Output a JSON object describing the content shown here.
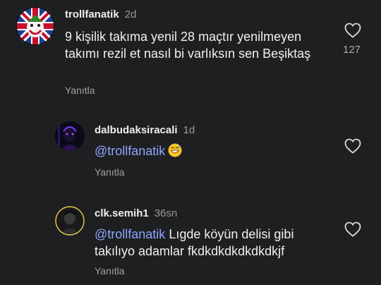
{
  "comments": [
    {
      "username": "trollfanatik",
      "time": "2d",
      "text": "9 kişilik takıma yenil 28 maçtır yenilmeyen takımı rezil et nasıl bi varlıksın sen Beşiktaş",
      "reply_label": "Yanıtla",
      "likes": "127"
    },
    {
      "username": "dalbudaksiracali",
      "time": "1d",
      "mention": "@trollfanatik",
      "text": "",
      "emoji": "grinning-sweat-face-emoji",
      "reply_label": "Yanıtla"
    },
    {
      "username": "clk.semih1",
      "time": "36sn",
      "mention": "@trollfanatik",
      "text": "Lıgde köyün delisi gibi takılıyo adamlar fkdkdkdkdkdkdkjf",
      "reply_label": "Yanıtla"
    }
  ],
  "colors": {
    "background": "#1e1f21",
    "mention": "#8fa6ff",
    "muted": "#9a9a9a"
  }
}
